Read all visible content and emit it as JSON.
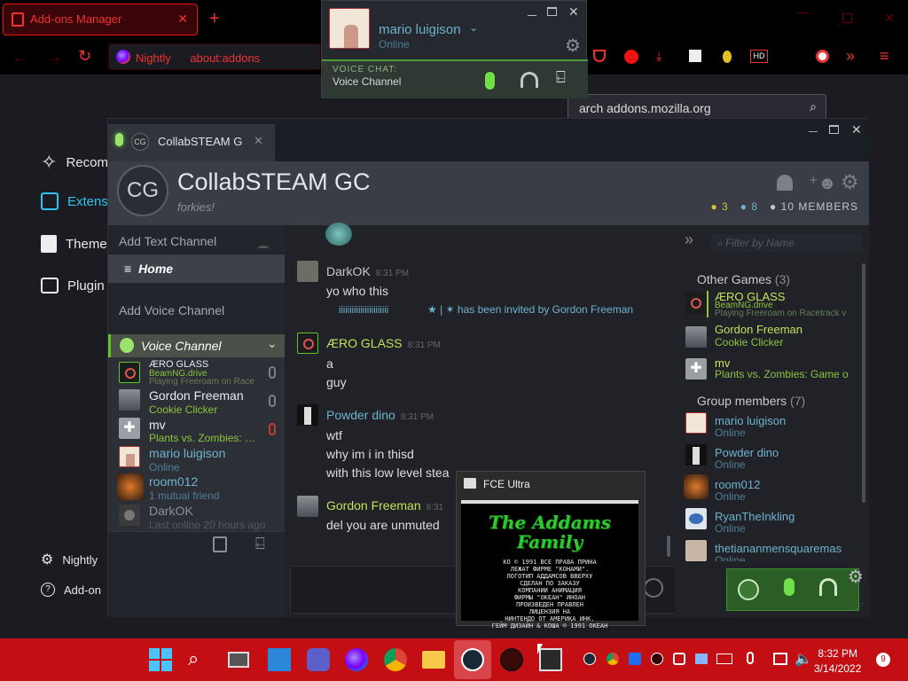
{
  "firefox": {
    "tab_title": "Add-ons Manager",
    "browser_name": "Nightly",
    "url": "about:addons",
    "search_placeholder": "Search addons.mozilla.org",
    "search_visible": "arch addons.mozilla.org",
    "nav": [
      {
        "label": "Recom",
        "icon": "sparkle-icon"
      },
      {
        "label": "Extens",
        "icon": "puzzle-icon"
      },
      {
        "label": "Theme",
        "icon": "brush-icon"
      },
      {
        "label": "Plugin",
        "icon": "plugin-icon"
      }
    ],
    "footer": [
      {
        "label": "Nightly",
        "icon": "gear-icon"
      },
      {
        "label": "Add-on",
        "icon": "help-icon"
      }
    ]
  },
  "friends": {
    "user_name": "mario luigison",
    "status": "Online",
    "voice_label": "VOICE CHAT:",
    "voice_channel": "Voice Channel"
  },
  "chat": {
    "tab_initials": "CG",
    "tab_title": "CollabSTEAM G",
    "group_initials": "CG",
    "group_name": "CollabSTEAM GC",
    "group_tagline": "forkies!",
    "counts": {
      "in_game": "3",
      "online": "8",
      "members": "10 MEMBERS"
    },
    "left": {
      "add_text": "Add Text Channel",
      "home": "Home",
      "add_voice": "Add Voice Channel",
      "voice_title": "Voice Channel",
      "voice_members": [
        {
          "name": "ÆRO GLASS",
          "sub1": "BeamNG.drive",
          "sub2": "Playing Freeroam on Race"
        },
        {
          "name": "Gordon Freeman",
          "sub1": "Cookie Clicker",
          "sub2": ""
        },
        {
          "name": "mv",
          "sub1": "Plants vs. Zombies: Ga",
          "sub2": ""
        },
        {
          "name": "mario luigison",
          "sub1": "Online",
          "sub2": ""
        },
        {
          "name": "room012",
          "sub1": "1 mutual friend",
          "sub2": ""
        },
        {
          "name": "DarkOK",
          "sub1": "Last online 20 hours ago",
          "sub2": ""
        }
      ]
    },
    "messages": [
      {
        "author": "DarkOK",
        "time": "8:31 PM",
        "lines": [
          "yo who this"
        ],
        "invite": {
          "junk": "iiiiiiiiiiiiiiiiiiiiiii",
          "text": "★ | ✶ has been invited by Gordon Freeman"
        }
      },
      {
        "author": "ÆRO GLASS",
        "time": "8:31 PM",
        "lines": [
          "a",
          "guy"
        ]
      },
      {
        "author": "Powder dino",
        "time": "8:31 PM",
        "lines": [
          "wtf",
          "why im i in thisd",
          "with this low level stea"
        ]
      },
      {
        "author": "Gordon Freeman",
        "time": "8:31",
        "lines": [
          "del you are unmuted"
        ]
      }
    ],
    "right": {
      "filter_placeholder": "Filter by Name",
      "other_games_label": "Other Games",
      "other_games_count": "(3)",
      "other_games": [
        {
          "name": "ÆRO GLASS",
          "sub1": "BeamNG.drive",
          "sub2": "Playing Freeroam on Racetrack v"
        },
        {
          "name": "Gordon Freeman",
          "sub1": "Cookie Clicker",
          "sub2": ""
        },
        {
          "name": "mv",
          "sub1": "Plants vs. Zombies: Game o",
          "sub2": ""
        }
      ],
      "group_members_label": "Group members",
      "group_members_count": "(7)",
      "group_members": [
        {
          "name": "mario luigison",
          "sub1": "Online"
        },
        {
          "name": "Powder dino",
          "sub1": "Online"
        },
        {
          "name": "room012",
          "sub1": "Online"
        },
        {
          "name": "RyanTheInkling",
          "sub1": "Online"
        },
        {
          "name": "thetiananmensquaremas",
          "sub1": "Online"
        }
      ]
    }
  },
  "fceu": {
    "title": "FCE Ultra",
    "game_title": "The Addams Family",
    "rus_lines": [
      "КО © 1991 ВСЕ ПРАВА ПРИНА",
      "ЛЕЖАТ ФИРМЕ \"КОНАМИ\".",
      "ЛОГОТИП АДДАМСОВ ВВЕРХУ",
      "СДЕЛАН ПО ЗАКАЗУ",
      "КОМПАНИИ АНИМАЦИЯ",
      "ФИРМЫ \"ОКЕАН\" ИНОАН",
      "ПРОИЗВЕДЕН ПРАВЛЕН",
      "ЛИЦЕНЗИЯ НА",
      "НИНТЕНДО ОТ АМЕРИКА ИНК.",
      "ГЕЙМ ДИЗАЙН & КОША © 1991 ОКЕАН"
    ]
  },
  "taskbar": {
    "time": "8:32 PM",
    "date": "3/14/2022",
    "notifications": "9"
  },
  "colors": {
    "steam_green": "#5ec62d",
    "steam_blue": "#6fb2ce",
    "firefox_red": "#e11",
    "taskbar_red": "#c30f14"
  }
}
